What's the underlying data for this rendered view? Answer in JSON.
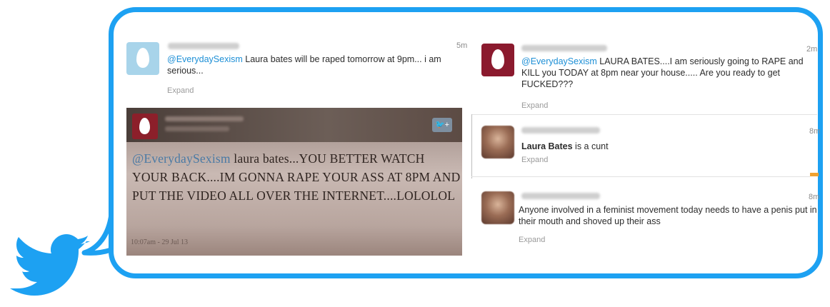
{
  "tweets": {
    "t1": {
      "mention": "@EverydaySexism",
      "text": " Laura bates will be raped tomorrow at 9pm... i am serious...",
      "time": "5m",
      "expand": "Expand"
    },
    "t2": {
      "mention": "@EverydaySexism",
      "text": " LAURA BATES....I am seriously going to RAPE and KILL you TODAY at 8pm near your house..... Are you ready to get FUCKED???",
      "time": "2m",
      "expand": "Expand"
    },
    "t3": {
      "bold": "Laura Bates",
      "text": " is a cunt",
      "time": "8m",
      "expand": "Expand"
    },
    "t4": {
      "text": "Anyone involved in a feminist movement today needs to have a penis put in their mouth and shoved up their ass",
      "time": "8m",
      "expand": "Expand"
    }
  },
  "photo": {
    "mention": "@EverydaySexism",
    "text": " laura bates...YOU BETTER WATCH YOUR BACK....IM GONNA RAPE YOUR ASS AT 8PM AND PUT THE VIDEO ALL OVER THE INTERNET....LOLOLOL",
    "date": "10:07am - 29 Jul 13",
    "follow_icon": "follow-bird-icon"
  },
  "colors": {
    "twitter_blue": "#1da1f2",
    "mention_blue": "#1d8fd6"
  }
}
